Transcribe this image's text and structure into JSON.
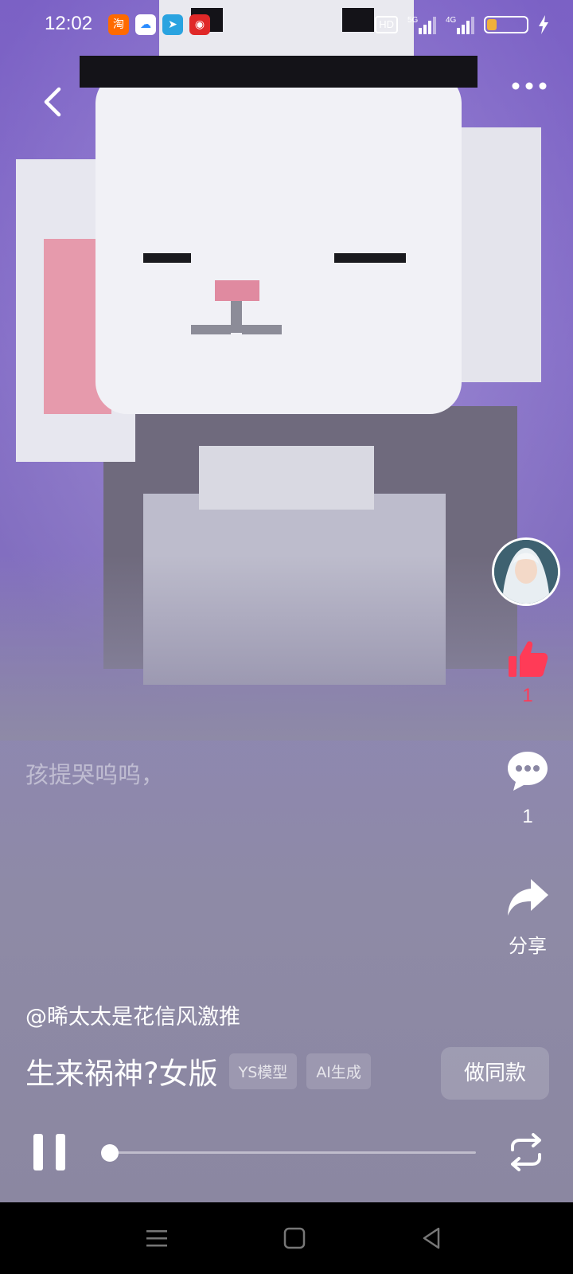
{
  "status_bar": {
    "time": "12:02",
    "apps": [
      {
        "name": "taobao-icon",
        "glyph": "淘",
        "color": "#ff6a00"
      },
      {
        "name": "cloud-app-icon",
        "glyph": "☁",
        "color": "#2a8cff"
      },
      {
        "name": "telegram-icon",
        "glyph": "➤",
        "color": "#2aa3e0"
      },
      {
        "name": "netease-music-icon",
        "glyph": "◉",
        "color": "#e02828"
      }
    ],
    "hd_label": "HD",
    "signal_1": "5G",
    "signal_2": "4G",
    "battery_level": 0.25
  },
  "rail": {
    "like_count": "1",
    "comment_count": "1",
    "share_label": "分享"
  },
  "content": {
    "caption": "孩提哭呜呜，",
    "author": "@晞太太是花信风激推",
    "title": "生来祸神?女版",
    "tags": [
      "YS模型",
      "AI生成"
    ],
    "make_same_label": "做同款"
  },
  "player": {
    "progress": 0.0
  },
  "colors": {
    "like_red": "#ff3b57",
    "bg_purple": "#8a87a3"
  }
}
